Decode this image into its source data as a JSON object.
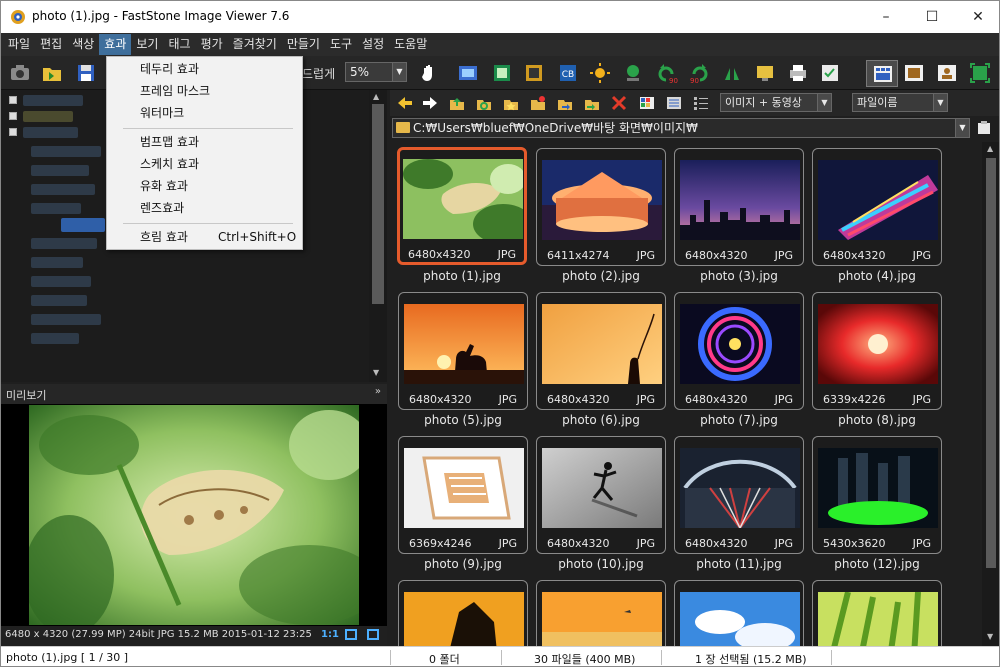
{
  "window": {
    "title": "photo (1).jpg  -  FastStone Image Viewer 7.6",
    "minimize": "–",
    "maximize": "☐",
    "close": "✕"
  },
  "menu": [
    "파일",
    "편집",
    "색상",
    "효과",
    "보기",
    "태그",
    "평가",
    "즐겨찾기",
    "만들기",
    "도구",
    "설정",
    "도움말"
  ],
  "active_menu": "효과",
  "effects_menu": {
    "items": [
      {
        "label": "테두리 효과",
        "shortcut": ""
      },
      {
        "label": "프레임 마스크",
        "shortcut": ""
      },
      {
        "label": "워터마크",
        "shortcut": ""
      },
      {
        "label": "범프맵 효과",
        "shortcut": ""
      },
      {
        "label": "스케치 효과",
        "shortcut": ""
      },
      {
        "label": "유화 효과",
        "shortcut": ""
      },
      {
        "label": "렌즈효과",
        "shortcut": ""
      },
      {
        "label": "흐림 효과",
        "shortcut": "Ctrl+Shift+O"
      }
    ]
  },
  "toolbar": {
    "smooth_label": "드럽게",
    "zoom_value": "5%"
  },
  "navbar": {
    "filter_value": "이미지 + 동영상",
    "sort_value": "파일이름",
    "path": "C:₩Users₩bluef₩OneDrive₩바탕 화면₩이미지₩"
  },
  "preview": {
    "header": "미리보기",
    "info": "6480 x 4320 (27.99 MP)  24bit  JPG  15.2 MB  2015-01-12 23:25",
    "ratio": "1:1"
  },
  "thumbnails": [
    {
      "name": "photo (1).jpg",
      "dims": "6480x4320",
      "type": "JPG",
      "selected": true
    },
    {
      "name": "photo (2).jpg",
      "dims": "6411x4274",
      "type": "JPG",
      "selected": false
    },
    {
      "name": "photo (3).jpg",
      "dims": "6480x4320",
      "type": "JPG",
      "selected": false
    },
    {
      "name": "photo (4).jpg",
      "dims": "6480x4320",
      "type": "JPG",
      "selected": false
    },
    {
      "name": "photo (5).jpg",
      "dims": "6480x4320",
      "type": "JPG",
      "selected": false
    },
    {
      "name": "photo (6).jpg",
      "dims": "6480x4320",
      "type": "JPG",
      "selected": false
    },
    {
      "name": "photo (7).jpg",
      "dims": "6480x4320",
      "type": "JPG",
      "selected": false
    },
    {
      "name": "photo (8).jpg",
      "dims": "6339x4226",
      "type": "JPG",
      "selected": false
    },
    {
      "name": "photo (9).jpg",
      "dims": "6369x4246",
      "type": "JPG",
      "selected": false
    },
    {
      "name": "photo (10).jpg",
      "dims": "6480x4320",
      "type": "JPG",
      "selected": false
    },
    {
      "name": "photo (11).jpg",
      "dims": "6480x4320",
      "type": "JPG",
      "selected": false
    },
    {
      "name": "photo (12).jpg",
      "dims": "5430x3620",
      "type": "JPG",
      "selected": false
    }
  ],
  "status": {
    "file": "photo (1).jpg [ 1 / 30 ]",
    "folders": "0 폴더",
    "files": "30 파일들 (400 MB)",
    "selected": "1 장 선택됨 (15.2 MB)"
  },
  "colors": {
    "selection_border": "#e55b2c",
    "menu_active": "#3f6f9c"
  }
}
